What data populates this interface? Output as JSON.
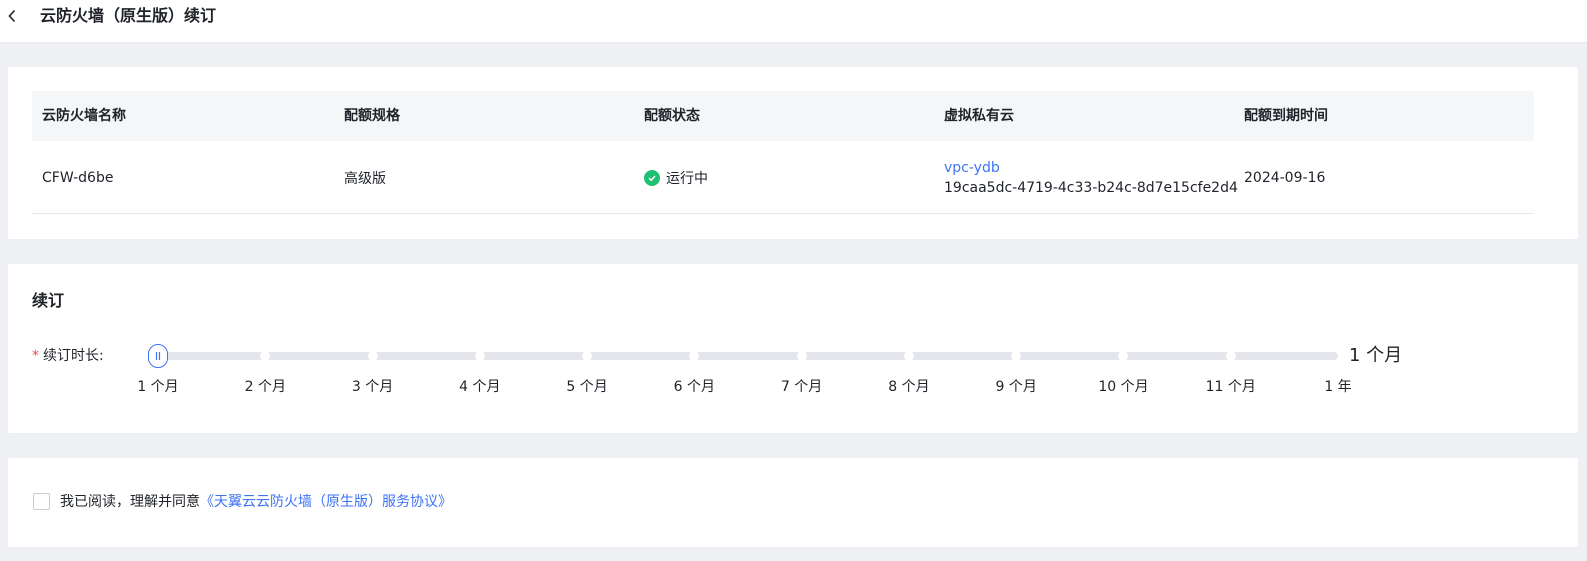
{
  "header": {
    "title": "云防火墙（原生版）续订",
    "back_icon": "chevron-left-icon"
  },
  "table": {
    "columns": [
      "云防火墙名称",
      "配额规格",
      "配额状态",
      "虚拟私有云",
      "配额到期时间"
    ],
    "row": {
      "name": "CFW-d6be",
      "spec": "高级版",
      "status": "运行中",
      "status_icon": "check-circle-icon",
      "vpc_name": "vpc-ydb",
      "vpc_id": "19caa5dc-4719-4c33-b24c-8d7e15cfe2d4",
      "expire": "2024-09-16"
    }
  },
  "renew": {
    "title": "续订",
    "required_mark": "*",
    "duration_label": "续订时长:",
    "selected_value": "1 个月",
    "selected_index": 0,
    "marks": [
      "1 个月",
      "2 个月",
      "3 个月",
      "4 个月",
      "5 个月",
      "6 个月",
      "7 个月",
      "8 个月",
      "9 个月",
      "10 个月",
      "11 个月",
      "1 年"
    ]
  },
  "agreement": {
    "checked": false,
    "text": "我已阅读，理解并同意",
    "link": "《天翼云云防火墙（原生版）服务协议》"
  },
  "colors": {
    "accent": "#3d73f5",
    "success": "#1fbf74",
    "required": "#f54a45"
  }
}
